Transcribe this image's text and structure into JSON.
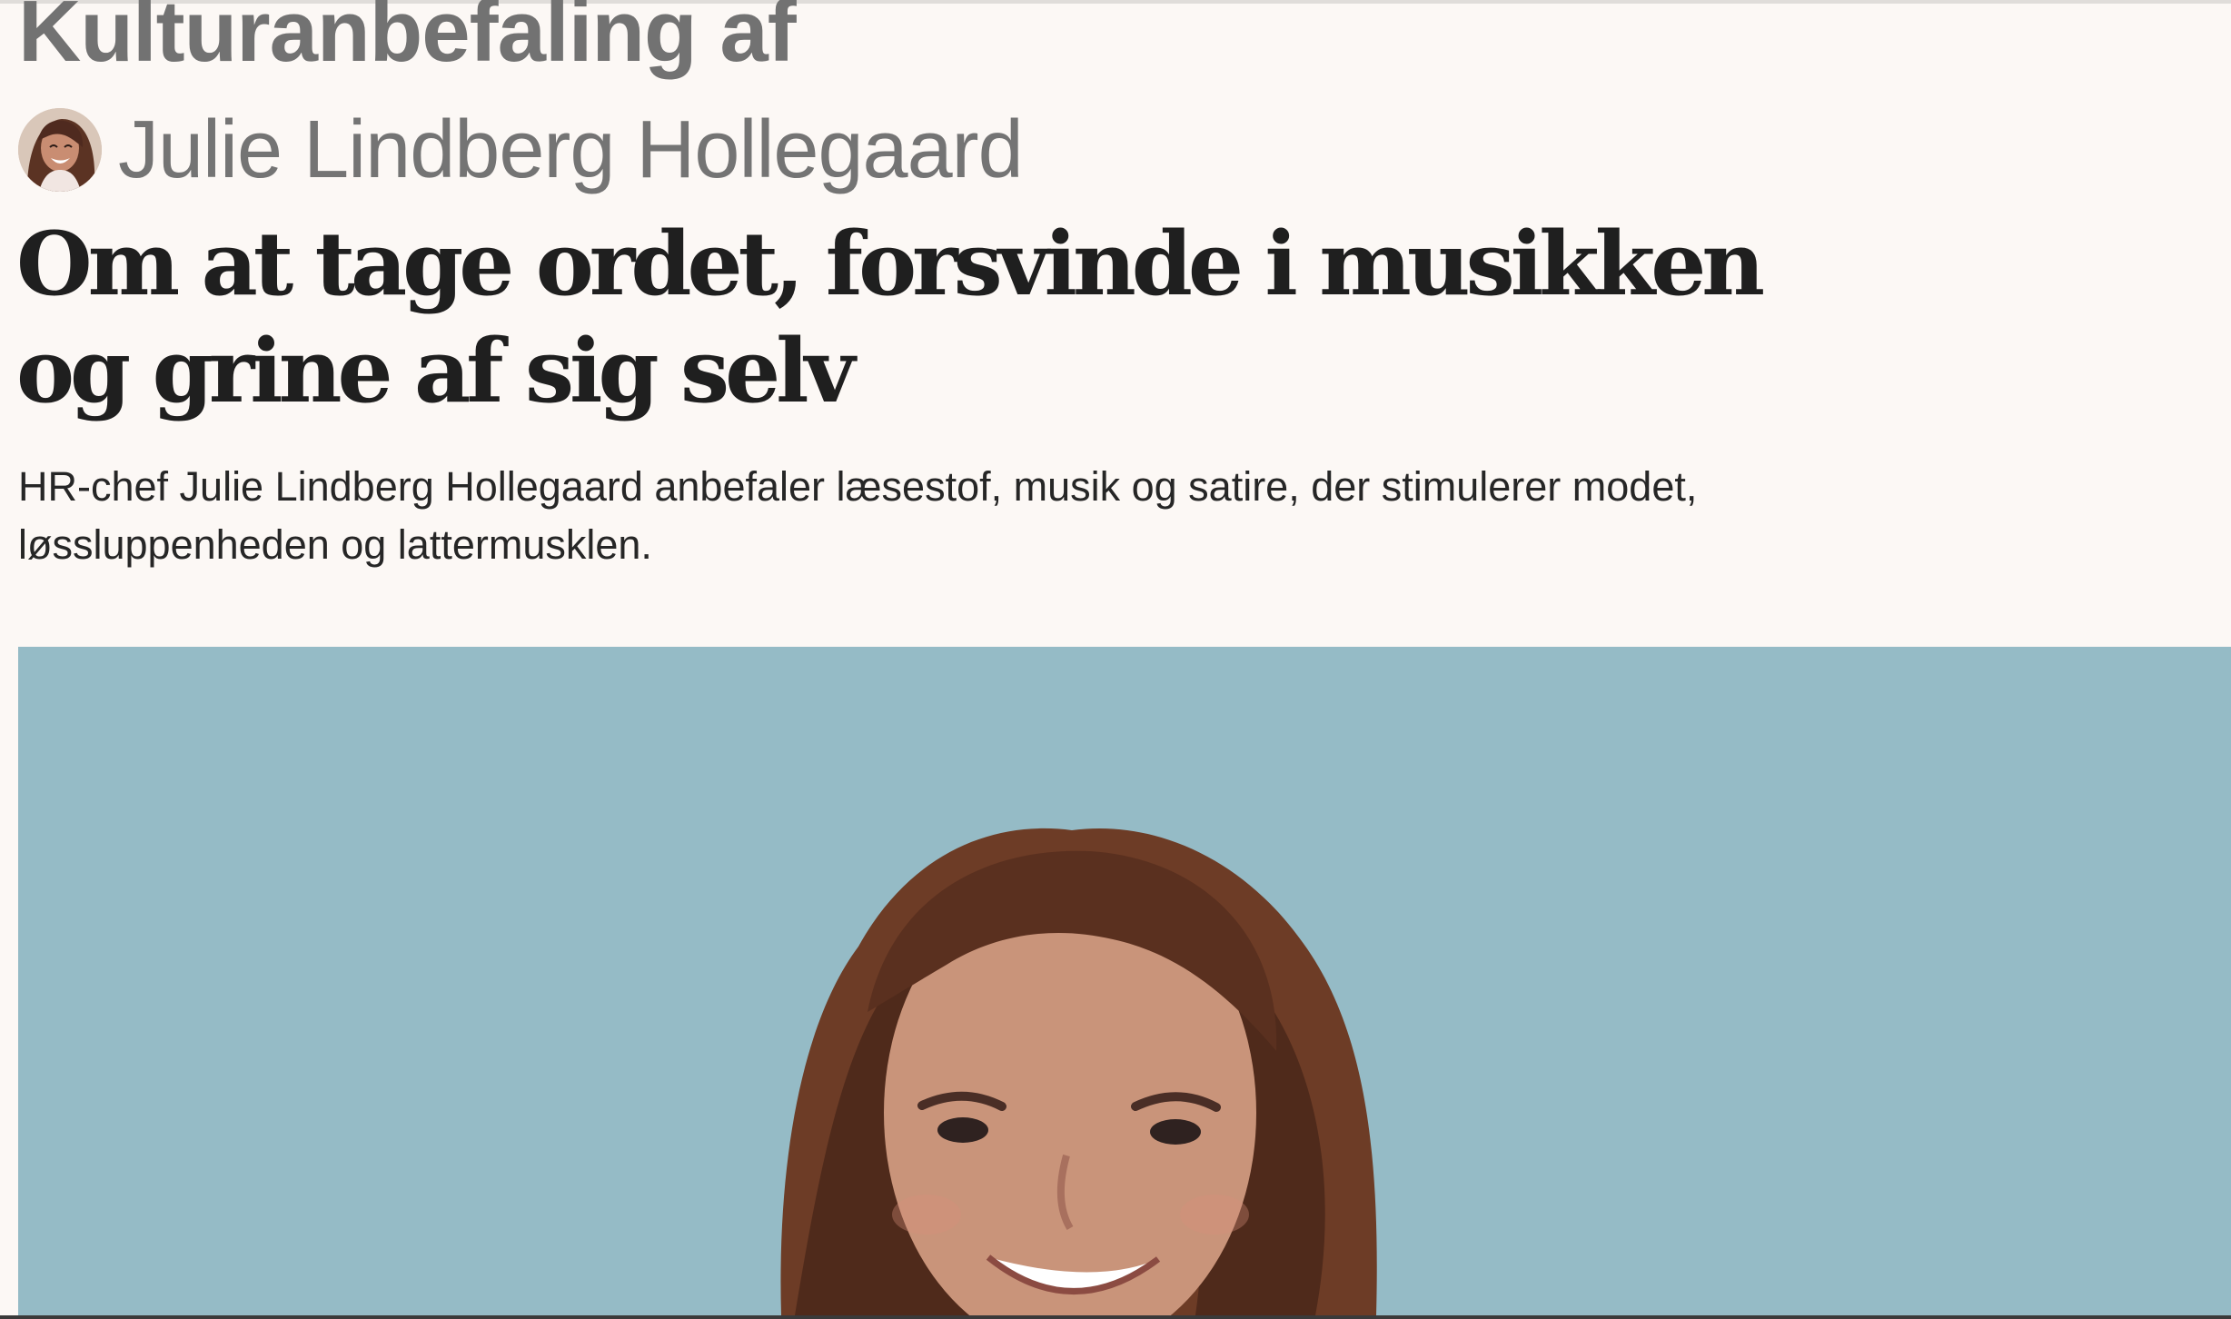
{
  "article": {
    "kicker": "Kulturanbefaling af",
    "author_name": "Julie Lindberg Hollegaard",
    "headline": "Om at tage ordet, forsvinde i musikken og grine af sig selv",
    "dek": "HR-chef Julie Lindberg Hollegaard anbefaler læsestof, musik og satire, der stimulerer modet, løssluppenheden og lattermusklen."
  },
  "images": {
    "avatar_icon": "author-avatar-photo",
    "hero_icon": "portrait-photo"
  },
  "colors": {
    "background": "#fcf8f5",
    "kicker": "#727272",
    "headline": "#1f1f1f",
    "hero_background": "#95bbc6"
  }
}
